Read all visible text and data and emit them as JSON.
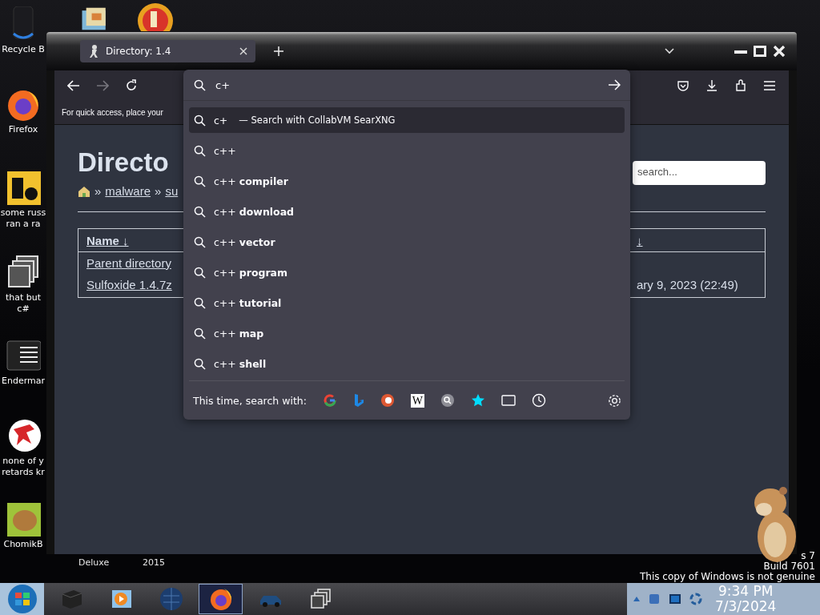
{
  "desktop": {
    "icons": [
      {
        "kind": "bin",
        "lines": [
          "Recycle B"
        ]
      },
      {
        "kind": "firefox",
        "lines": [
          "Firefox"
        ]
      },
      {
        "kind": "tile",
        "lines": [
          "some russ",
          "ran a ra"
        ]
      },
      {
        "kind": "stack",
        "lines": [
          "that but",
          "c#"
        ]
      },
      {
        "kind": "terminal",
        "lines": [
          "Endermar"
        ]
      },
      {
        "kind": "dino",
        "lines": [
          "none of y",
          "retards kr"
        ]
      },
      {
        "kind": "hamster",
        "lines": [
          "ChomikB"
        ]
      }
    ],
    "bottom_labels": [
      "Deluxe",
      "2015"
    ],
    "watermark": [
      "s 7",
      "Build 7601",
      "This copy of Windows is not genuine"
    ]
  },
  "browser": {
    "tab": {
      "title": "Directory: 1.4"
    },
    "bookmarks_hint": "For quick access, place your",
    "page": {
      "heading": "Directo",
      "breadcrumb": [
        {
          "kind": "sep",
          "text": "»"
        },
        {
          "kind": "link",
          "text": "malware"
        },
        {
          "kind": "sep",
          "text": "»"
        },
        {
          "kind": "link",
          "text": "su"
        }
      ],
      "search": {
        "placeholder": "search..."
      },
      "columns": [
        "Name ↓",
        "↓"
      ],
      "rows": [
        {
          "name": "Parent directory"
        },
        {
          "name": "Sulfoxide 1.4.7z",
          "column_2": "ary 9, 2023 (22:49)"
        }
      ]
    },
    "urlbar": {
      "value": "c+"
    },
    "suggestions": [
      {
        "text": "c+",
        "action": "— Search with CollabVM SearXNG",
        "selected": true
      },
      {
        "text": "c++",
        "selected": false
      },
      {
        "text": "c++ **compiler**",
        "selected": false
      },
      {
        "text": "c++ **download**",
        "selected": false
      },
      {
        "text": "c++ **vector**",
        "selected": false
      },
      {
        "text": "c++ **program**",
        "selected": false
      },
      {
        "text": "c++ **tutorial**",
        "selected": false
      },
      {
        "text": "c++ **map**",
        "selected": false
      },
      {
        "text": "c++ **shell**",
        "selected": false
      }
    ],
    "search_with": "This time, search with:",
    "engines": [
      {
        "kind": "google"
      },
      {
        "kind": "bing"
      },
      {
        "kind": "ddg"
      },
      {
        "kind": "wiki",
        "glyph": "W"
      },
      {
        "kind": "searx"
      },
      {
        "kind": "bookmarks"
      },
      {
        "kind": "tabs"
      },
      {
        "kind": "history"
      }
    ]
  },
  "taskbar": {
    "buttons": [
      {
        "kind": "box",
        "active": false
      },
      {
        "kind": "player",
        "active": false
      },
      {
        "kind": "globe",
        "active": false
      },
      {
        "kind": "firefox",
        "active": true
      },
      {
        "kind": "car",
        "active": false
      },
      {
        "kind": "stack",
        "active": false
      }
    ],
    "time": "9:34 PM",
    "date": "7/3/2024"
  }
}
